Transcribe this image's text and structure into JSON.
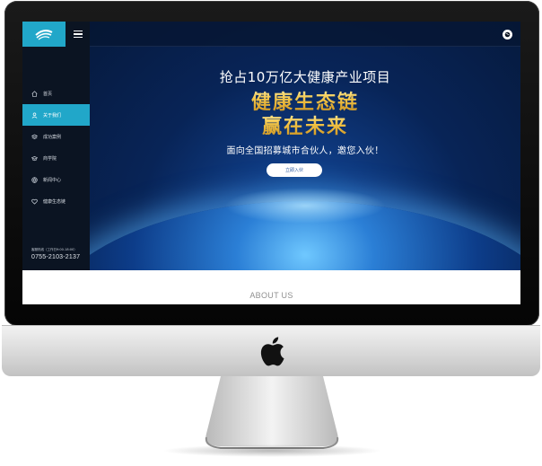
{
  "sidebar": {
    "logo_icon": "brand-swirl-logo",
    "menu_icon": "hamburger-icon",
    "items": [
      {
        "label": "首页",
        "icon": "home-icon",
        "active": false
      },
      {
        "label": "关于我们",
        "icon": "user-icon",
        "active": true
      },
      {
        "label": "成功案例",
        "icon": "layers-icon",
        "active": false
      },
      {
        "label": "商学院",
        "icon": "graduation-icon",
        "active": false
      },
      {
        "label": "新闻中心",
        "icon": "globe-icon",
        "active": false
      },
      {
        "label": "健康生态链",
        "icon": "heart-icon",
        "active": false
      }
    ],
    "contact_small": "客服热线（工作日9:00-18:00）",
    "contact_phone": "0755-2103-2137"
  },
  "topbar": {
    "language_icon": "globe-icon"
  },
  "hero": {
    "line1": "抢占10万亿大健康产业项目",
    "line2": "健康生态链",
    "line3": "赢在未来",
    "subtitle": "面向全国招募城市合伙人，邀您入伙！",
    "button": "立即入伙"
  },
  "section": {
    "about": "ABOUT US"
  },
  "colors": {
    "accent": "#21a7c9",
    "sidebar_bg": "#0b1422",
    "gold": "#f1c24a",
    "hero_bg": "#082457"
  }
}
